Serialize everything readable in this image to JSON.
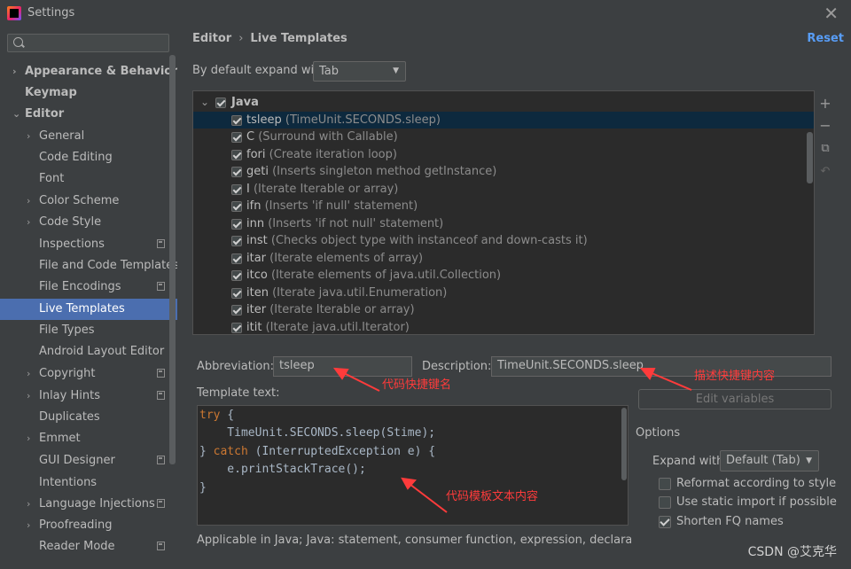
{
  "window": {
    "title": "Settings"
  },
  "sidebar": {
    "search_placeholder": "",
    "items": [
      {
        "label": "Appearance & Behavior",
        "bold": true,
        "arrow": "›"
      },
      {
        "label": "Keymap",
        "bold": true,
        "arrow": ""
      },
      {
        "label": "Editor",
        "bold": true,
        "arrow": "⌄"
      },
      {
        "label": "General",
        "arrow": "›"
      },
      {
        "label": "Code Editing",
        "arrow": ""
      },
      {
        "label": "Font",
        "arrow": ""
      },
      {
        "label": "Color Scheme",
        "arrow": "›"
      },
      {
        "label": "Code Style",
        "arrow": "›"
      },
      {
        "label": "Inspections",
        "arrow": "",
        "proj": true
      },
      {
        "label": "File and Code Templates",
        "arrow": ""
      },
      {
        "label": "File Encodings",
        "arrow": "",
        "proj": true
      },
      {
        "label": "Live Templates",
        "arrow": "",
        "selected": true
      },
      {
        "label": "File Types",
        "arrow": ""
      },
      {
        "label": "Android Layout Editor",
        "arrow": ""
      },
      {
        "label": "Copyright",
        "arrow": "›",
        "proj": true
      },
      {
        "label": "Inlay Hints",
        "arrow": "›",
        "proj": true
      },
      {
        "label": "Duplicates",
        "arrow": ""
      },
      {
        "label": "Emmet",
        "arrow": "›"
      },
      {
        "label": "GUI Designer",
        "arrow": "",
        "proj": true
      },
      {
        "label": "Intentions",
        "arrow": ""
      },
      {
        "label": "Language Injections",
        "arrow": "›",
        "proj": true
      },
      {
        "label": "Proofreading",
        "arrow": "›"
      },
      {
        "label": "Reader Mode",
        "arrow": "",
        "proj": true
      }
    ]
  },
  "header": {
    "crumb_parent": "Editor",
    "crumb_sep": "›",
    "crumb_current": "Live Templates",
    "reset": "Reset"
  },
  "expand": {
    "label": "By default expand with",
    "value": "Tab"
  },
  "templates": {
    "group": "Java",
    "rows": [
      {
        "abbr": "tsleep",
        "desc": "(TimeUnit.SECONDS.sleep)",
        "selected": true
      },
      {
        "abbr": "C",
        "desc": "(Surround with Callable)"
      },
      {
        "abbr": "fori",
        "desc": "(Create iteration loop)"
      },
      {
        "abbr": "geti",
        "desc": "(Inserts singleton method getInstance)"
      },
      {
        "abbr": "I",
        "desc": "(Iterate Iterable or array)"
      },
      {
        "abbr": "ifn",
        "desc": "(Inserts 'if null' statement)"
      },
      {
        "abbr": "inn",
        "desc": "(Inserts 'if not null' statement)"
      },
      {
        "abbr": "inst",
        "desc": "(Checks object type with instanceof and down-casts it)"
      },
      {
        "abbr": "itar",
        "desc": "(Iterate elements of array)"
      },
      {
        "abbr": "itco",
        "desc": "(Iterate elements of java.util.Collection)"
      },
      {
        "abbr": "iten",
        "desc": "(Iterate java.util.Enumeration)"
      },
      {
        "abbr": "iter",
        "desc": "(Iterate Iterable or array)"
      },
      {
        "abbr": "itit",
        "desc": "(Iterate java.util.Iterator)"
      }
    ]
  },
  "form": {
    "abbreviation_label": "Abbreviation:",
    "abbreviation_value": "tsleep",
    "description_label": "Description:",
    "description_value": "TimeUnit.SECONDS.sleep",
    "template_text_label": "Template text:",
    "edit_variables": "Edit variables",
    "code": {
      "l1_kw": "try",
      "l1_rest": " {",
      "l2": "    TimeUnit.SECONDS.sleep(Stime);",
      "l3_a": "} ",
      "l3_kw": "catch",
      "l3_rest": " (InterruptedException e) {",
      "l4": "    e.printStackTrace();",
      "l5": "}"
    },
    "applicable": "Applicable in Java; Java: statement, consumer function, expression, declaration, comm"
  },
  "options": {
    "title": "Options",
    "expand_with_label": "Expand with",
    "expand_with_value": "Default (Tab)",
    "reformat": "Reformat according to style",
    "static_import": "Use static import if possible",
    "shorten_fq": "Shorten FQ names"
  },
  "annotations": {
    "abbr_note": "代码快捷键名",
    "desc_note": "描述快捷键内容",
    "code_note": "代码模板文本内容"
  },
  "watermark": "CSDN @艾克华"
}
